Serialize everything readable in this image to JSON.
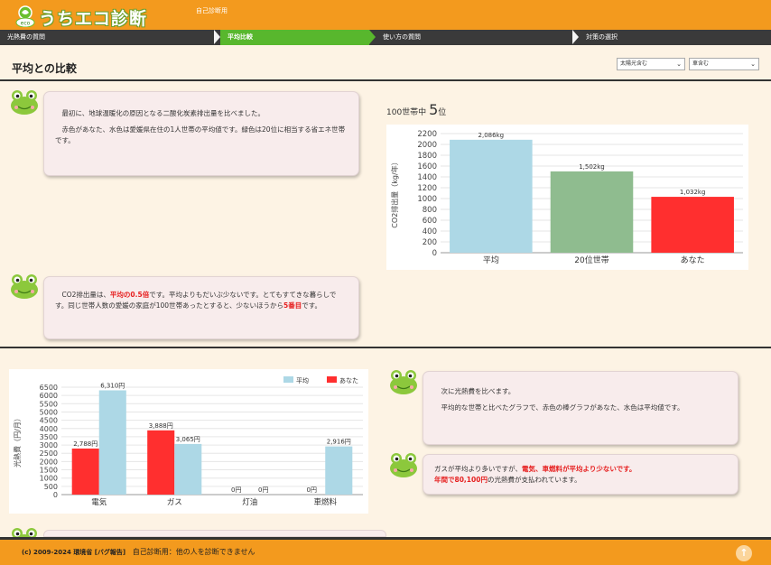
{
  "header": {
    "logo_badge": "eco",
    "logo_text": "うちエコ診断",
    "mode_label": "自己診断用"
  },
  "steps": [
    {
      "label": "光熱費の質問",
      "active": false
    },
    {
      "label": "平均比較",
      "active": true
    },
    {
      "label": "使い方の質問",
      "active": false
    },
    {
      "label": "対策の選択",
      "active": false
    }
  ],
  "page_title": "平均との比較",
  "selects": {
    "solar": "太陽光含む",
    "car": "車含む"
  },
  "bubbles": {
    "intro_p1": "最初に、地球温暖化の原因となる二酸化炭素排出量を比べました。",
    "intro_p2": "赤色があなた、水色は愛媛県在住の1人世帯の平均値です。緑色は20位に相当する省エネ世帯です。",
    "co2_a": "CO2排出量は、",
    "co2_hl1": "平均の0.5倍",
    "co2_b": "です。平均よりもだいぶ少ないです。とてもすてきな暮らしです。同じ世帯人数の愛媛の家庭が100世帯あったとすると、少ないほうから",
    "co2_hl2": "5番目",
    "co2_c": "です。",
    "cost_p1": "次に光熱費を比べます。",
    "cost_p2": "平均的な世帯と比べたグラフで、赤色の棒グラフがあなた、水色は平均値です。",
    "cost2_a": "ガスが平均より多いですが、",
    "cost2_hl1": "電気、車燃料が平均より少ないです。",
    "cost2_hl2": "年間で80,100円",
    "cost2_b": "の光熱費が支払われています。"
  },
  "rank": {
    "prefix": "100世帯中",
    "number": "5",
    "suffix": "位"
  },
  "chart_data": [
    {
      "type": "bar",
      "title": "",
      "ylabel": "CO2排出量（kg/年）",
      "ylim": [
        0,
        2200
      ],
      "yticks": [
        0,
        200,
        400,
        600,
        800,
        1000,
        1200,
        1400,
        1600,
        1800,
        2000,
        2200
      ],
      "categories": [
        "平均",
        "20位世帯",
        "あなた"
      ],
      "values": [
        2086,
        1502,
        1032
      ],
      "value_labels": [
        "2,086kg",
        "1,502kg",
        "1,032kg"
      ],
      "colors": [
        "#add8e6",
        "#8fbc8f",
        "#ff2f2f"
      ],
      "grid": true
    },
    {
      "type": "bar",
      "title": "",
      "ylabel": "光熱費（円/月）",
      "ylim": [
        0,
        6500
      ],
      "yticks": [
        0,
        500,
        1000,
        1500,
        2000,
        2500,
        3000,
        3500,
        4000,
        4500,
        5000,
        5500,
        6000,
        6500
      ],
      "categories": [
        "電気",
        "ガス",
        "灯油",
        "車燃料"
      ],
      "series": [
        {
          "name": "平均",
          "values": [
            6310,
            3065,
            0,
            2916
          ],
          "labels": [
            "6,310円",
            "3,065円",
            "0円",
            "2,916円"
          ],
          "color": "#add8e6"
        },
        {
          "name": "あなた",
          "values": [
            2788,
            3888,
            0,
            0
          ],
          "labels": [
            "2,788円",
            "3,888円",
            "0円",
            "0円"
          ],
          "color": "#ff2f2f"
        }
      ],
      "legend": "top-right",
      "grid": true
    }
  ],
  "footer": {
    "copyright": "(c) 2009-2024 環境省 [バグ報告]",
    "note": "自己診断用：他の人を診断できません",
    "totop": "↑"
  }
}
